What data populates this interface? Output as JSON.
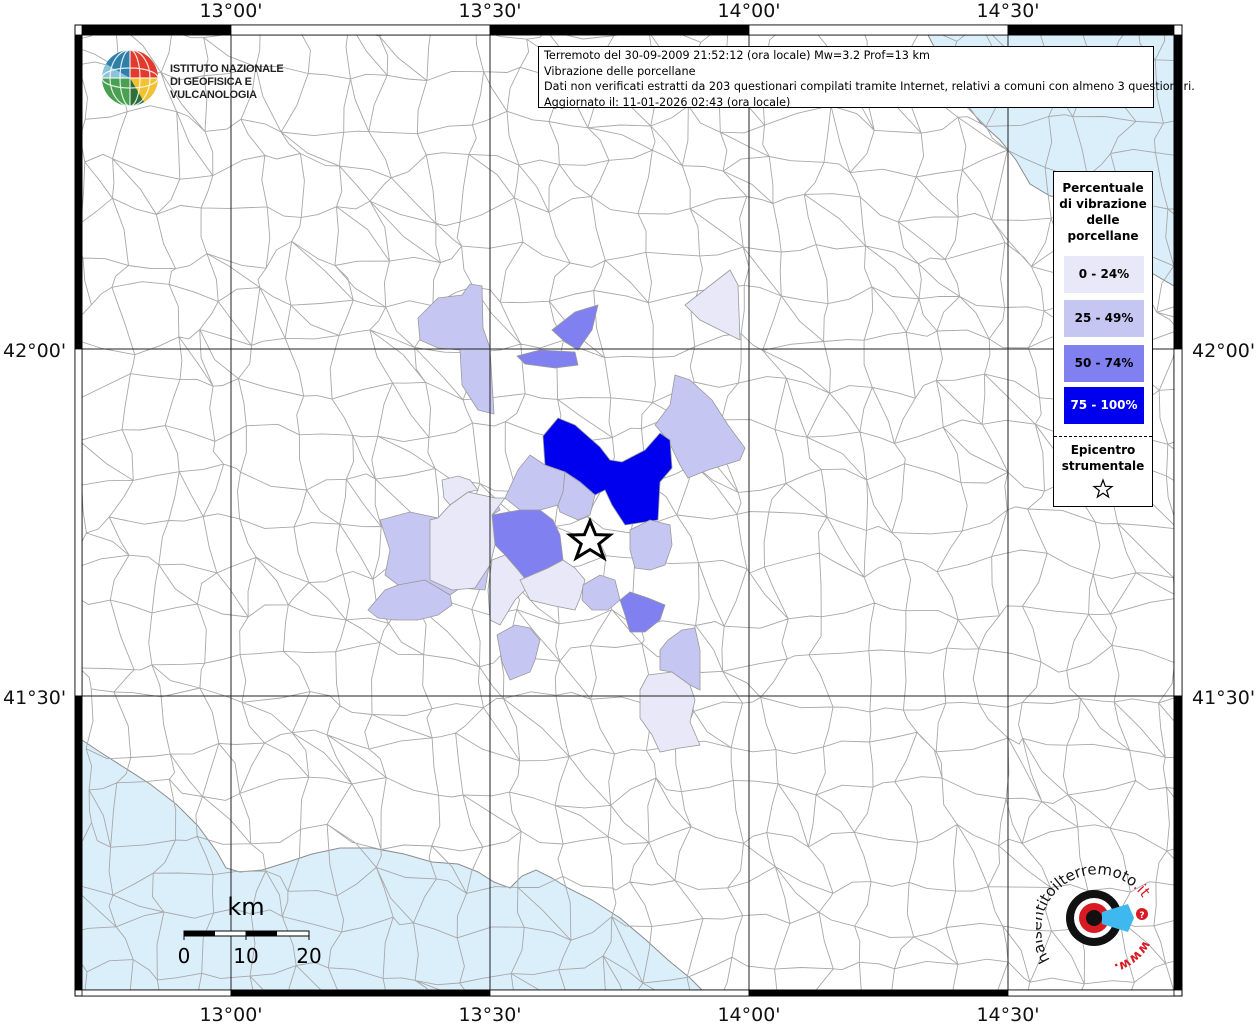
{
  "info": {
    "line1": "Terremoto del 30-09-2009 21:52:12 (ora locale) Mw=3.2 Prof=13 km",
    "line2": "Vibrazione delle porcellane",
    "line3": "Dati non verificati estratti da 203 questionari compilati tramite Internet, relativi a comuni con almeno 3 questionari.",
    "line4": "Aggiornato il: 11-01-2026 02:43 (ora locale)"
  },
  "logo": {
    "line1": "ISTITUTO NAZIONALE",
    "line2": "DI GEOFISICA E VULCANOLOGIA"
  },
  "axes": {
    "lon_labels": [
      "13°00'",
      "13°30'",
      "14°00'",
      "14°30'"
    ],
    "lat_labels": [
      "42°00'",
      "41°30'"
    ]
  },
  "legend": {
    "title_lines": [
      "Percentuale",
      "di vibrazione",
      "delle",
      "porcellane"
    ],
    "classes": [
      {
        "label": "0 - 24%",
        "color": "#e8e8f8",
        "text_color": "#000000"
      },
      {
        "label": "25 - 49%",
        "color": "#c6c6f2",
        "text_color": "#000000"
      },
      {
        "label": "50 - 74%",
        "color": "#8080f0",
        "text_color": "#000000"
      },
      {
        "label": "75 - 100%",
        "color": "#0000ee",
        "text_color": "#ffffff"
      }
    ],
    "epicenter_lines": [
      "Epicentro",
      "strumentale"
    ]
  },
  "scale": {
    "unit": "km",
    "ticks": [
      "0",
      "10",
      "20"
    ]
  },
  "badge": {
    "text_main": "haisentitoilterremoto",
    "text_it": ".it",
    "text_www": "www."
  },
  "colors": {
    "sea": "#dbeffb",
    "border": "#a8a8a8",
    "grid": "#222222"
  }
}
